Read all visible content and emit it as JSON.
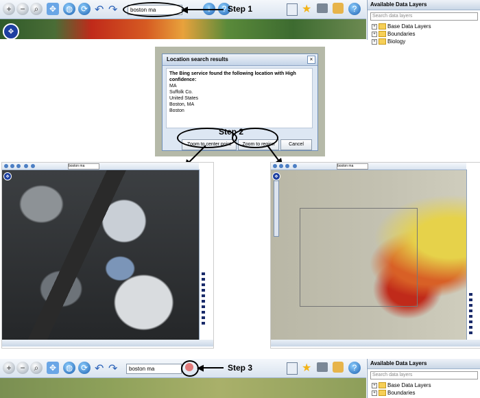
{
  "top_toolbar": {
    "search_value": "boston ma",
    "step_label": "Step 1"
  },
  "bottom_toolbar": {
    "search_value": "boston ma",
    "step_label": "Step 3"
  },
  "data_panel": {
    "title": "Available Data Layers",
    "search_placeholder": "Search data layers",
    "items": [
      "Base Data Layers",
      "Boundaries",
      "Biology"
    ]
  },
  "data_panel_bottom": {
    "title": "Available Data Layers",
    "search_placeholder": "Search data layers",
    "items": [
      "Base Data Layers",
      "Boundaries"
    ]
  },
  "dialog": {
    "title": "Location search results",
    "heading": "The Bing service found the following location with High confidence:",
    "lines": [
      "MA",
      "Suffolk Co.",
      "United States",
      "Boston, MA",
      "Boston"
    ],
    "step_label": "Step 2",
    "buttons": {
      "center": "Zoom to center point",
      "region": "Zoom to region",
      "cancel": "Cancel"
    }
  },
  "mini_left": {
    "search_value": "boston ma"
  },
  "mini_right": {
    "search_value": "boston ma"
  },
  "colors": {
    "toolbar": "#d9e3ef",
    "accent": "#1b5fb0",
    "folder": "#f6cf57",
    "bathymetry_red": "#c02a1a"
  },
  "icons": [
    "zoom-in-icon",
    "zoom-out-icon",
    "zoom-box-icon",
    "pan-icon",
    "globe-icon",
    "refresh-icon",
    "undo-icon",
    "redo-icon",
    "info-icon",
    "add-layer-icon",
    "star-icon",
    "print-icon",
    "export-icon",
    "help-icon"
  ]
}
